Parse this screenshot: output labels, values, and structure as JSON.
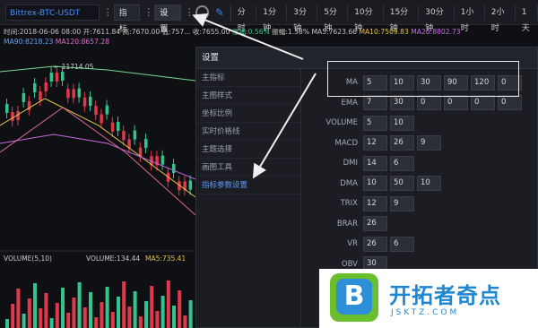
{
  "toolbar": {
    "symbol": "Bittrex-BTC-USDT",
    "indicator_label": "指标",
    "settings_label": "设置",
    "periods": [
      "分时",
      "1分钟",
      "3分钟",
      "5分钟",
      "10分钟",
      "15分钟",
      "30分钟",
      "1小时",
      "2小时",
      "1天"
    ]
  },
  "info_line": {
    "time": "时间:2018-06-06 08:00",
    "open": "开:7611.84",
    "high": "高:7670.00",
    "low": "低:757...",
    "close": "收:7655.00",
    "change": "涨幅:0.56%",
    "amplitude": "振幅:1.38%",
    "ma5": "MA5:7623.66",
    "ma10": "MA10:7509.83",
    "ma20": "MA20:8802.73"
  },
  "info_line2": {
    "ma90": "MA90:8218.23",
    "ma120": "MA120:8657.28"
  },
  "chart": {
    "high_marker": "← 11714.05",
    "volume_label": "VOLUME(5,10)",
    "volume_value": "VOLUME:134.44",
    "volume_ma5": "MA5:735.41"
  },
  "dialog": {
    "title": "设置",
    "menu": [
      "主指标",
      "主图样式",
      "坐标比例",
      "实时价格线",
      "主题选择",
      "画图工具",
      "指标参数设置"
    ],
    "active_menu": "指标参数设置",
    "params": [
      {
        "name": "MA",
        "values": [
          "5",
          "10",
          "30",
          "90",
          "120",
          "0"
        ]
      },
      {
        "name": "EMA",
        "values": [
          "7",
          "30",
          "0",
          "0",
          "0",
          "0"
        ]
      },
      {
        "name": "VOLUME",
        "values": [
          "5",
          "10"
        ]
      },
      {
        "name": "MACD",
        "values": [
          "12",
          "26",
          "9"
        ]
      },
      {
        "name": "DMI",
        "values": [
          "14",
          "6"
        ]
      },
      {
        "name": "DMA",
        "values": [
          "10",
          "50",
          "10"
        ]
      },
      {
        "name": "TRIX",
        "values": [
          "12",
          "9"
        ]
      },
      {
        "name": "BRAR",
        "values": [
          "26"
        ]
      },
      {
        "name": "VR",
        "values": [
          "26",
          "6"
        ]
      },
      {
        "name": "OBV",
        "values": [
          "30"
        ]
      }
    ]
  },
  "watermark": {
    "logo_letter": "B",
    "name": "开拓者奇点",
    "url": "JSKTZ.COM"
  },
  "colors": {
    "up": "#34c38f",
    "down": "#e0394a",
    "accent": "#4a8cf0"
  }
}
